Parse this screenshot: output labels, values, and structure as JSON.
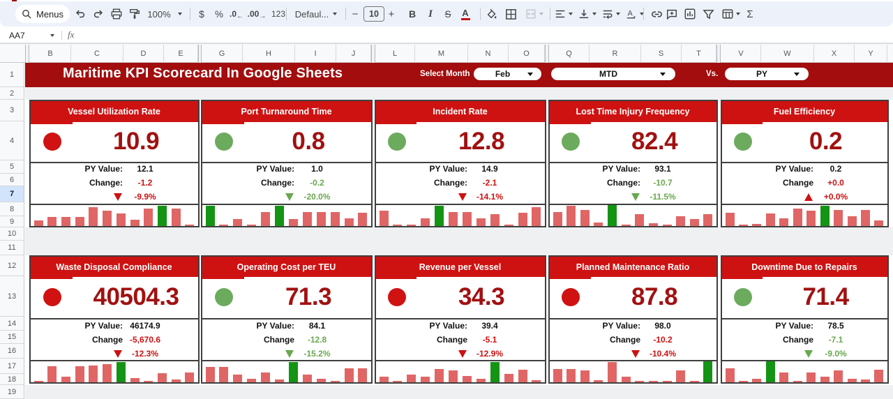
{
  "toolbar": {
    "menus_label": "Menus",
    "undo": "undo",
    "redo": "redo",
    "print": "print",
    "paint_format": "paint-format",
    "zoom": "100%",
    "currency": "$",
    "percent": "%",
    "decrease_decimal": ".0",
    "increase_decimal": ".00",
    "more_formats": "123",
    "font_name": "Defaul...",
    "minus": "−",
    "font_size": "10",
    "plus": "+",
    "bold": "B",
    "italic": "I",
    "strikethrough": "S",
    "text_color": "A",
    "sigma": "Σ"
  },
  "formula_bar": {
    "name_box": "AA7",
    "fx_label": "fx"
  },
  "column_headers": [
    "B",
    "C",
    "D",
    "E",
    "G",
    "H",
    "I",
    "J",
    "L",
    "M",
    "N",
    "O",
    "Q",
    "R",
    "S",
    "T",
    "V",
    "W",
    "X",
    "Y"
  ],
  "row_headers": [
    "1",
    "2",
    "3",
    "4",
    "5",
    "6",
    "7",
    "8",
    "9",
    "10",
    "11",
    "12",
    "13",
    "14",
    "15",
    "16",
    "17",
    "18",
    "19"
  ],
  "selected_row": "7",
  "banner": {
    "title": "Maritime KPI Scorecard In Google Sheets",
    "select_month_label": "Select Month",
    "month": "Feb",
    "period": "MTD",
    "vs_label": "Vs.",
    "compare": "PY"
  },
  "colors": {
    "banner_red": "#a30d0d",
    "card_header_red": "#ce1212",
    "value_dark_red": "#a11111",
    "negative_red": "#cc1111",
    "positive_green": "#6aa84f",
    "circle_red": "#d01212",
    "circle_green": "#6cab5d",
    "bar_salmon": "#e06666",
    "bar_green": "#149414",
    "toolbar_bg": "#edf2fa",
    "sheet_gray": "#edeff2",
    "selected_row_bg": "#d2e3fc"
  },
  "cards": [
    {
      "title": "Vessel Utilization Rate",
      "value": "10.9",
      "status": "red",
      "py_label": "PY Value:",
      "py_value": "12.1",
      "change_label": "Change:",
      "change_value": "-1.2",
      "change_color": "red",
      "pct": "-9.9%",
      "pct_color": "red",
      "direction": "down",
      "bars": [
        0.28,
        0.42,
        0.44,
        0.42,
        0.91,
        0.72,
        0.61,
        0.31,
        0.82,
        0.95,
        0.83,
        0.04
      ],
      "green_bars": [
        9
      ]
    },
    {
      "title": "Port Turnaround Time",
      "value": "0.8",
      "status": "green",
      "py_label": "PY Value:",
      "py_value": "1.0",
      "change_label": "Change:",
      "change_value": "-0.2",
      "change_color": "green",
      "pct": "-20.0%",
      "pct_color": "green",
      "direction": "down",
      "bars": [
        0.95,
        0.04,
        0.32,
        0.04,
        0.65,
        0.95,
        0.33,
        0.65,
        0.65,
        0.65,
        0.35,
        0.63
      ],
      "green_bars": [
        0,
        5
      ]
    },
    {
      "title": "Incident Rate",
      "value": "12.8",
      "status": "green",
      "py_label": "PY Value:",
      "py_value": "14.9",
      "change_label": "Change:",
      "change_value": "-2.1",
      "change_color": "red",
      "pct": "-14.1%",
      "pct_color": "red",
      "direction": "down",
      "bars": [
        0.72,
        0.08,
        0.08,
        0.38,
        0.95,
        0.68,
        0.68,
        0.38,
        0.55,
        0.04,
        0.62,
        0.9
      ],
      "green_bars": [
        4
      ]
    },
    {
      "title": "Lost Time Injury Frequency",
      "value": "82.4",
      "status": "green",
      "py_label": "PY Value:",
      "py_value": "93.1",
      "change_label": "Change:",
      "change_value": "-10.7",
      "change_color": "green",
      "pct": "-11.5%",
      "pct_color": "green",
      "direction": "down",
      "bars": [
        0.68,
        0.95,
        0.78,
        0.15,
        1.0,
        0.06,
        0.58,
        0.14,
        0.04,
        0.45,
        0.32,
        0.55
      ],
      "green_bars": [
        4
      ]
    },
    {
      "title": "Fuel Efficiency",
      "value": "0.2",
      "status": "green",
      "py_label": "PY Value:",
      "py_value": "0.2",
      "change_label": "Change",
      "change_value": "+0.0",
      "change_color": "red",
      "pct": "+0.0%",
      "pct_color": "red",
      "direction": "up",
      "bars": [
        0.62,
        0.04,
        0.1,
        0.6,
        0.38,
        0.82,
        0.72,
        0.95,
        0.78,
        0.48,
        0.75,
        0.28
      ],
      "green_bars": [
        7
      ]
    },
    {
      "title": "Waste Disposal Compliance",
      "value": "40504.3",
      "status": "red",
      "py_label": "PY Value:",
      "py_value": "46174.9",
      "change_label": "Change",
      "change_value": "-5,670.6",
      "change_color": "red",
      "pct": "-12.3%",
      "pct_color": "red",
      "direction": "down",
      "bars": [
        0.04,
        0.75,
        0.25,
        0.78,
        0.8,
        0.85,
        0.95,
        0.2,
        0.05,
        0.42,
        0.12,
        0.45
      ],
      "green_bars": [
        6
      ]
    },
    {
      "title": "Operating Cost per TEU",
      "value": "71.3",
      "status": "green",
      "py_label": "PY Value:",
      "py_value": "84.1",
      "change_label": "Change",
      "change_value": "-12.8",
      "change_color": "green",
      "pct": "-15.2%",
      "pct_color": "green",
      "direction": "down",
      "bars": [
        0.72,
        0.72,
        0.38,
        0.15,
        0.45,
        0.12,
        0.95,
        0.35,
        0.15,
        0.03,
        0.65,
        0.65
      ],
      "green_bars": [
        6
      ]
    },
    {
      "title": "Revenue per Vessel",
      "value": "34.3",
      "status": "red",
      "py_label": "PY Value:",
      "py_value": "39.4",
      "change_label": "Change",
      "change_value": "-5.1",
      "change_color": "red",
      "pct": "-12.9%",
      "pct_color": "red",
      "direction": "down",
      "bars": [
        0.25,
        0.03,
        0.38,
        0.25,
        0.62,
        0.58,
        0.3,
        0.15,
        0.95,
        0.4,
        0.6,
        0.1
      ],
      "green_bars": [
        8
      ]
    },
    {
      "title": "Planned Maintenance Ratio",
      "value": "87.8",
      "status": "red",
      "py_label": "PY Value:",
      "py_value": "98.0",
      "change_label": "Change",
      "change_value": "-10.2",
      "change_color": "red",
      "pct": "-10.4%",
      "pct_color": "red",
      "direction": "down",
      "bars": [
        0.62,
        0.62,
        0.58,
        0.1,
        0.95,
        0.25,
        0.04,
        0.08,
        0.06,
        0.55,
        0.03,
        1.0
      ],
      "green_bars": [
        11
      ]
    },
    {
      "title": "Downtime Due to Repairs",
      "value": "71.4",
      "status": "green",
      "py_label": "PY Value:",
      "py_value": "78.5",
      "change_label": "Change",
      "change_value": "-7.1",
      "change_color": "green",
      "pct": "-9.0%",
      "pct_color": "green",
      "direction": "down",
      "bars": [
        0.65,
        0.04,
        0.15,
        1.0,
        0.45,
        0.06,
        0.45,
        0.28,
        0.55,
        0.18,
        0.12,
        0.6
      ],
      "green_bars": [
        3
      ]
    }
  ]
}
